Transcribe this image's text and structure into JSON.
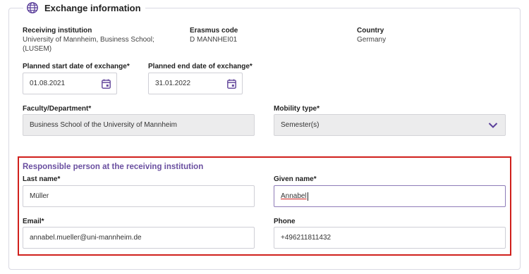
{
  "section": {
    "title": "Exchange information",
    "icon": "globe-icon"
  },
  "receiving": {
    "institution_label": "Receiving institution",
    "institution_value_line1": "University of Mannheim, Business School;",
    "institution_value_line2": "(LUSEM)",
    "erasmus_label": "Erasmus code",
    "erasmus_value": "D MANNHEI01",
    "country_label": "Country",
    "country_value": "Germany"
  },
  "dates": {
    "start_label": "Planned start date of exchange*",
    "start_value": "01.08.2021",
    "end_label": "Planned end date of exchange*",
    "end_value": "31.01.2022"
  },
  "faculty": {
    "label": "Faculty/Department*",
    "value": "Business School of the University of Mannheim"
  },
  "mobility": {
    "label": "Mobility type*",
    "value": "Semester(s)"
  },
  "responsible": {
    "title": "Responsible person at the receiving institution",
    "last_name_label": "Last name*",
    "last_name_value": "Müller",
    "given_name_label": "Given name*",
    "given_name_value": "Annabel",
    "email_label": "Email*",
    "email_value": "annabel.mueller@uni-mannheim.de",
    "phone_label": "Phone",
    "phone_value": "+496211811432"
  },
  "colors": {
    "accent": "#6a4fa0",
    "highlight_border": "#d0201c"
  }
}
